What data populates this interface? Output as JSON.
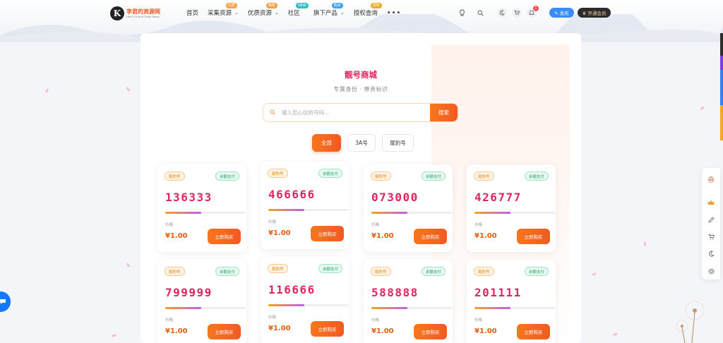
{
  "header": {
    "logo_mark": "K",
    "logo_title": "李君的资源网",
    "logo_subtitle": "Lee's Circle of Trade Works",
    "nav": [
      {
        "label": "首页",
        "chevron": false,
        "badge": null
      },
      {
        "label": "采集资源",
        "chevron": true,
        "badge": "优质",
        "badge_color": "orange"
      },
      {
        "label": "优质资源",
        "chevron": true,
        "badge": "推荐",
        "badge_color": "orange"
      },
      {
        "label": "社区",
        "chevron": false,
        "badge": "NEW",
        "badge_color": "teal"
      },
      {
        "label": "旗下产品",
        "chevron": true,
        "badge": "购买",
        "badge_color": "blue"
      },
      {
        "label": "授权查询",
        "chevron": false,
        "badge": "授权",
        "badge_color": "amber"
      }
    ],
    "more": "•••",
    "notification_count": "1",
    "publish_label": "✎ 发布",
    "vip_label": "♛ 开通会员"
  },
  "shop": {
    "title": "靓号商城",
    "subtitle": "专属身份 · 尊贵标识",
    "search_placeholder": "输入您心仪的号码...",
    "search_button": "搜索",
    "filters": [
      "全部",
      "3A号",
      "尾豹号"
    ],
    "active_filter": "全部"
  },
  "card_labels": {
    "tag": "尾豹号",
    "pay": "余额支付",
    "price_label": "价格",
    "buy": "立即购买"
  },
  "cards": [
    {
      "number": "136333",
      "price": "¥1.00",
      "progress": 0.45
    },
    {
      "number": "466666",
      "price": "¥1.00",
      "progress": 0.45
    },
    {
      "number": "073000",
      "price": "¥1.00",
      "progress": 0.45
    },
    {
      "number": "426777",
      "price": "¥1.00",
      "progress": 0.45
    },
    {
      "number": "799999",
      "price": "¥1.00",
      "progress": 0.45
    },
    {
      "number": "116666",
      "price": "¥1.00",
      "progress": 0.45
    },
    {
      "number": "588888",
      "price": "¥1.00",
      "progress": 0.45
    },
    {
      "number": "201111",
      "price": "¥1.00",
      "progress": 0.45
    }
  ],
  "colors": {
    "accent": "#f25a22",
    "number": "#e0245e",
    "price": "#e85c0d"
  }
}
